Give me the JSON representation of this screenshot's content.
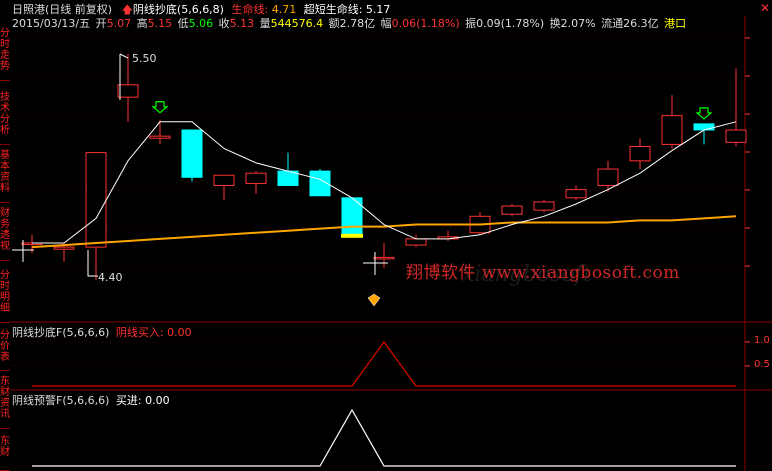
{
  "header": {
    "stock_title": "日照港(日线 前复权)",
    "indicator": "阴线抄底(5,6,6,8)",
    "life_label": "生命线:",
    "life_value": "4.71",
    "ultra_label": "超短生命线:",
    "ultra_value": "5.17",
    "date": "2015/03/13/五",
    "open_label": "开",
    "open": "5.07",
    "high_label": "高",
    "high": "5.15",
    "low_label": "低",
    "low": "5.06",
    "close_label": "收",
    "close": "5.13",
    "volume_label": "量",
    "volume": "544576.4",
    "amount_label": "额",
    "amount": "2.78亿",
    "change_label": "幅",
    "change": "0.06(1.18%)",
    "amplitude_label": "振",
    "amplitude": "0.09(1.78%)",
    "turnover_label": "换",
    "turnover": "2.07%",
    "float_label": "流通",
    "float": "26.3亿",
    "sector": "港口"
  },
  "sidebar": {
    "tabs": [
      "分时走势",
      "技术分析",
      "基本资料",
      "财务透视",
      "分时明细",
      "分价表",
      "东财资讯",
      "东财"
    ]
  },
  "annotations": {
    "high_mark": "5.50",
    "low_mark": "4.40"
  },
  "watermark": {
    "text": "翔博软件 www.xiangbosoft.com",
    "shadow": "xiangbosoft"
  },
  "panel1": {
    "title": "阴线抄底F(5,6,6,6)",
    "series_label": "阴线买入:",
    "series_value": "0.00",
    "axis_ticks": [
      "1.0",
      "0.5"
    ]
  },
  "panel2": {
    "title": "阴线预警F(5,6,6,6)",
    "series_label": "买进:",
    "series_value": "0.00"
  },
  "colors": {
    "up": "#ff3232",
    "down": "#00ffff",
    "life_line": "#ffa500",
    "ultra_line": "#ffffff",
    "panel1_line": "#e00000",
    "panel2_line": "#ffffff",
    "signal_arrow": "#00ff00"
  },
  "chart_data": [
    {
      "type": "candlestick",
      "title": "日照港(日线 前复权)",
      "candles": [
        {
          "o": 4.58,
          "h": 4.62,
          "l": 4.53,
          "c": 4.58
        },
        {
          "o": 4.55,
          "h": 4.58,
          "l": 4.49,
          "c": 4.56
        },
        {
          "o": 4.56,
          "h": 5.02,
          "l": 4.4,
          "c": 5.02
        },
        {
          "o": 5.29,
          "h": 5.5,
          "l": 5.17,
          "c": 5.35
        },
        {
          "o": 5.09,
          "h": 5.18,
          "l": 5.06,
          "c": 5.1
        },
        {
          "o": 5.13,
          "h": 5.13,
          "l": 4.88,
          "c": 4.9
        },
        {
          "o": 4.86,
          "h": 4.91,
          "l": 4.79,
          "c": 4.91
        },
        {
          "o": 4.87,
          "h": 4.93,
          "l": 4.82,
          "c": 4.92
        },
        {
          "o": 4.93,
          "h": 5.02,
          "l": 4.86,
          "c": 4.86
        },
        {
          "o": 4.93,
          "h": 4.94,
          "l": 4.81,
          "c": 4.81
        },
        {
          "o": 4.8,
          "h": 4.8,
          "l": 4.62,
          "c": 4.62
        },
        {
          "o": 4.51,
          "h": 4.58,
          "l": 4.46,
          "c": 4.51
        },
        {
          "o": 4.57,
          "h": 4.62,
          "l": 4.56,
          "c": 4.6
        },
        {
          "o": 4.6,
          "h": 4.64,
          "l": 4.59,
          "c": 4.61
        },
        {
          "o": 4.63,
          "h": 4.73,
          "l": 4.62,
          "c": 4.71
        },
        {
          "o": 4.72,
          "h": 4.77,
          "l": 4.71,
          "c": 4.76
        },
        {
          "o": 4.74,
          "h": 4.79,
          "l": 4.73,
          "c": 4.78
        },
        {
          "o": 4.8,
          "h": 4.86,
          "l": 4.79,
          "c": 4.84
        },
        {
          "o": 4.86,
          "h": 4.98,
          "l": 4.83,
          "c": 4.94
        },
        {
          "o": 4.98,
          "h": 5.09,
          "l": 4.94,
          "c": 5.05
        },
        {
          "o": 5.06,
          "h": 5.3,
          "l": 5.04,
          "c": 5.2
        },
        {
          "o": 5.16,
          "h": 5.15,
          "l": 5.06,
          "c": 5.13
        },
        {
          "o": 5.07,
          "h": 5.43,
          "l": 5.05,
          "c": 5.13
        }
      ],
      "ultra_short_life_line": [
        4.58,
        4.58,
        4.7,
        4.98,
        5.17,
        5.17,
        5.04,
        4.97,
        4.93,
        4.89,
        4.8,
        4.67,
        4.6,
        4.6,
        4.62,
        4.67,
        4.71,
        4.77,
        4.84,
        4.92,
        5.03,
        5.13,
        5.17
      ],
      "life_line": [
        4.56,
        4.57,
        4.58,
        4.59,
        4.6,
        4.61,
        4.62,
        4.63,
        4.64,
        4.65,
        4.66,
        4.66,
        4.67,
        4.67,
        4.67,
        4.68,
        4.68,
        4.68,
        4.68,
        4.69,
        4.69,
        4.7,
        4.71
      ],
      "signals": [
        {
          "index": 4,
          "type": "buy-arrow"
        },
        {
          "index": 21,
          "type": "buy-arrow"
        }
      ]
    },
    {
      "type": "line",
      "title": "阴线抄底F(5,6,6,6)",
      "series": [
        {
          "name": "阴线买入",
          "values": [
            0,
            0,
            0,
            0,
            0,
            0,
            0,
            0,
            0,
            0,
            0,
            1,
            0,
            0,
            0,
            0,
            0,
            0,
            0,
            0,
            0,
            0,
            0
          ]
        }
      ],
      "ylim": [
        0,
        1
      ]
    },
    {
      "type": "line",
      "title": "阴线预警F(5,6,6,6)",
      "series": [
        {
          "name": "买进",
          "values": [
            0,
            0,
            0,
            0,
            0,
            0,
            0,
            0,
            0,
            0,
            1,
            0,
            0,
            0,
            0,
            0,
            0,
            0,
            0,
            0,
            0,
            0,
            0
          ]
        }
      ],
      "ylim": [
        0,
        1
      ]
    }
  ]
}
